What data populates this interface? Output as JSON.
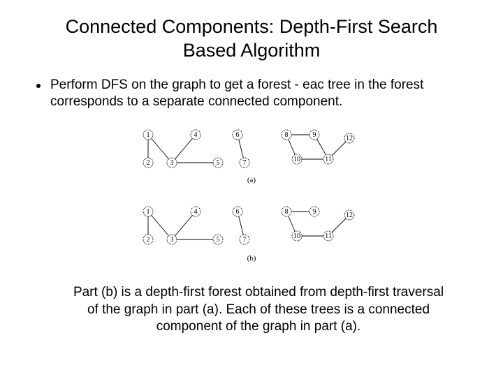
{
  "title": "Connected Components: Depth-First Search Based Algorithm",
  "bullet": "Perform DFS on the graph to get a forest - eac tree in the forest corresponds to a separate connected component.",
  "caption": "Part (b) is a depth-first forest obtained from depth-first traversal of the graph in part (a). Each of these trees is a connected component of the graph in part (a).",
  "figure": {
    "label_a": "(a)",
    "label_b": "(b)",
    "nodes": [
      "1",
      "2",
      "3",
      "4",
      "5",
      "6",
      "7",
      "8",
      "9",
      "10",
      "11",
      "12"
    ],
    "part_a": {
      "components": [
        {
          "nodes": [
            1,
            2,
            3,
            4,
            5
          ],
          "edges": [
            [
              1,
              2
            ],
            [
              1,
              3
            ],
            [
              3,
              4
            ],
            [
              3,
              5
            ]
          ]
        },
        {
          "nodes": [
            6,
            7
          ],
          "edges": [
            [
              6,
              7
            ]
          ]
        },
        {
          "nodes": [
            8,
            9,
            10,
            11,
            12
          ],
          "edges": [
            [
              8,
              9
            ],
            [
              8,
              10
            ],
            [
              9,
              11
            ],
            [
              10,
              11
            ],
            [
              11,
              12
            ]
          ]
        }
      ]
    },
    "part_b": {
      "trees": [
        {
          "root": 1,
          "edges": [
            [
              1,
              2
            ],
            [
              1,
              3
            ],
            [
              3,
              4
            ],
            [
              3,
              5
            ]
          ]
        },
        {
          "root": 6,
          "edges": [
            [
              6,
              7
            ]
          ]
        },
        {
          "root": 8,
          "edges": [
            [
              8,
              9
            ],
            [
              8,
              10
            ],
            [
              10,
              11
            ],
            [
              11,
              12
            ]
          ]
        }
      ]
    }
  }
}
